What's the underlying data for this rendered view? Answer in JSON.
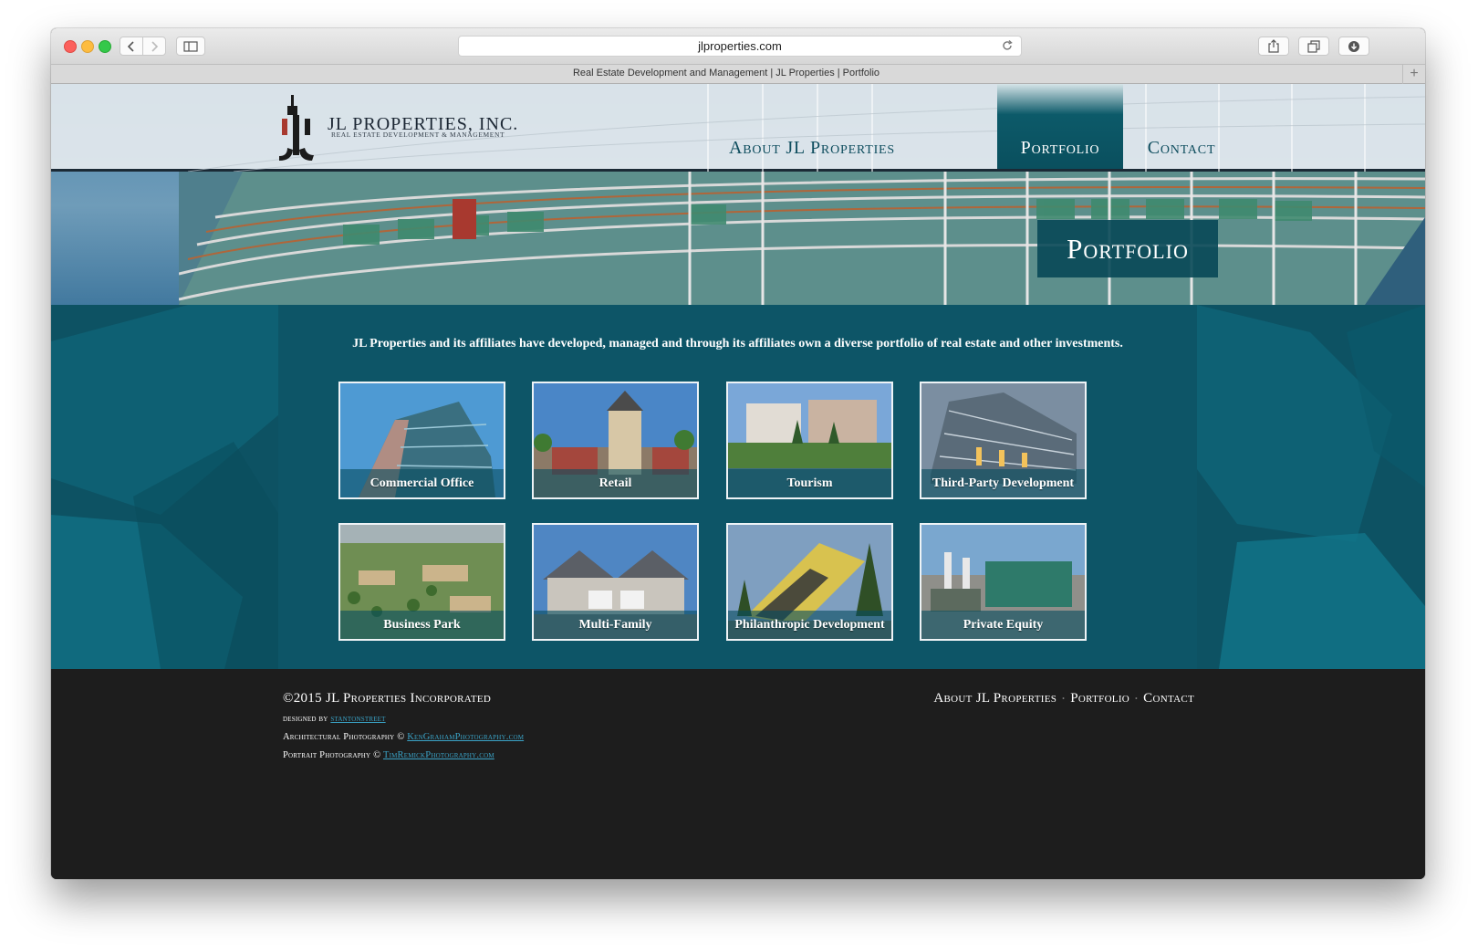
{
  "browser": {
    "url": "jlproperties.com",
    "tab_title": "Real Estate Development and Management | JL Properties | Portfolio",
    "new_tab": "+"
  },
  "brand": {
    "name": "JL PROPERTIES, INC.",
    "tagline": "REAL ESTATE DEVELOPMENT & MANAGEMENT",
    "colors": {
      "teal": "#0d5263",
      "dark": "#1d1d1d",
      "accent_link": "#3aa3c7"
    }
  },
  "nav": [
    {
      "label": "About JL Properties",
      "active": false
    },
    {
      "label": "Portfolio",
      "active": true
    },
    {
      "label": "Contact",
      "active": false
    }
  ],
  "hero": {
    "title": "Portfolio"
  },
  "intro": "JL Properties and its affiliates have developed, managed and through its affiliates own a diverse portfolio of real estate and other investments.",
  "tiles": [
    {
      "label": "Commercial Office"
    },
    {
      "label": "Retail"
    },
    {
      "label": "Tourism"
    },
    {
      "label": "Third-Party Development"
    },
    {
      "label": "Business Park"
    },
    {
      "label": "Multi-Family"
    },
    {
      "label": "Philanthropic Development"
    },
    {
      "label": "Private Equity"
    }
  ],
  "footer": {
    "copyright": "©2015 JL Properties Incorporated",
    "designed_prefix": "designed by",
    "designed_link": "stantonstreet",
    "arch_prefix": "Architectural Photography ©",
    "arch_link": "KenGrahamPhotography.com",
    "portrait_prefix": "Portrait Photography ©",
    "portrait_link": "TimRemickPhotography.com",
    "nav": [
      "About JL Properties",
      "Portfolio",
      "Contact"
    ]
  }
}
